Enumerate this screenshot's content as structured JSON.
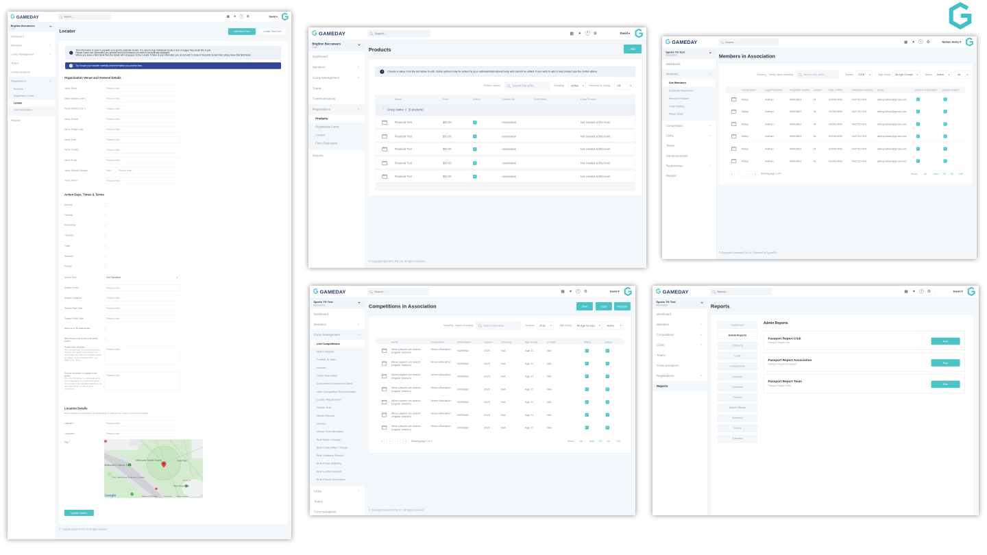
{
  "common": {
    "brand": "GAMEDAY",
    "search_placeholder": "Search...",
    "table_search_placeholder": "Search this table...",
    "accent": "#4cc3c7",
    "tip_color": "#2f4795",
    "icons": [
      "building-icon",
      "rocket-icon",
      "help-icon",
      "settings-icon"
    ]
  },
  "panels": {
    "locator": {
      "user": "David",
      "sidebar": {
        "org_name": "Brighton Buccaneers",
        "org_type": "Club",
        "items": [
          {
            "label": "Dashboard"
          },
          {
            "label": "Members",
            "expandable": true
          },
          {
            "label": "Comp Management",
            "expandable": true
          },
          {
            "label": "Teams"
          },
          {
            "label": "Communications"
          },
          {
            "label": "Registrations",
            "expandable": true,
            "open": true,
            "sub": [
              {
                "label": "Products"
              },
              {
                "label": "Registration Forms"
              },
              {
                "label": "Locator",
                "active": true
              },
              {
                "label": "Form Restrictions"
              }
            ]
          },
          {
            "label": "Reports"
          }
        ]
      },
      "title": "Locator",
      "actions": [
        "Add New Form",
        "Create Test Form"
      ],
      "info": [
        "This information is used to populate your sport's postcode locator. It is used to help individuals locate a club or league they would like to join.",
        "Please ensure the information you provide here is information you wish to be publically displayed.",
        "Where you leave a field blank then the details will not appear on the Locator. If there is any information you do not wish to show in the public locator then simply leave that field blank."
      ],
      "tip": "Tip: Ensure you consider carefully what information you provide here.",
      "section_venue": "Organisation Venue and General Details",
      "placeholder": "Please enter...",
      "venue_fields": [
        "Venue Name",
        "Venue Address Line 1",
        "Venue Address Line 2",
        "Venue Suburb",
        "Venue Postal Code",
        "Venue State",
        "Venue Country",
        "Venue Email",
        "Venue Website Address",
        "Venue Phone"
      ],
      "website_prefix": "http://",
      "section_days": "Active Days, Times & Terms",
      "days": [
        "Monday",
        "Tuesday",
        "Wednesday",
        "Thursday",
        "Friday",
        "Saturday",
        "Sunday"
      ],
      "school_term": {
        "label": "School Term",
        "value": "Not Specified"
      },
      "season_fields": [
        "Season Times",
        "Season Durations",
        "Season Start Date",
        "Season Finish Date"
      ],
      "public_checks": [
        "Show me in the public locator",
        "Show fixtures and results in the public locator"
      ],
      "textareas": [
        {
          "label": "Postal Codes Serviced",
          "help": "(You can just enter the postcodes a club services to a range of 10 relevant and local codes. You can enter multiple values by using a comma between them. eg. 3000, 3121, 3032)"
        },
        {
          "label": "General information to display on the locator",
          "help": "(Tip: Use this section to tell people about your organisation or provide information not covered in the standard fields here. It's your opportunity to make a great impression.)"
        }
      ],
      "section_location": "Location Details",
      "location_hint": "Enter Latitude and Longitude in the boxes below or drag the map marker to the correct location.",
      "location_fields": [
        "Latitude",
        "Longitude"
      ],
      "map_label": "Map",
      "required_mark": "*",
      "map": {
        "labels": [
          "Melbourne Cricket Ground",
          "Yarra Park",
          "Melbourne & Olympic Parks",
          "Rod Laver Arena Temporary Carpark",
          "Punt Road Oval",
          "Royal Vic"
        ],
        "google": "Google",
        "attribution": "Map data ©2020 Google",
        "terms": "Terms of Use",
        "report": "Report a map error"
      },
      "submit": "Update Locator",
      "footer": "© Copyright SportsTG Pty Ltd. All rights reserved."
    },
    "products": {
      "user": "David",
      "sidebar": {
        "org_name": "Brighton Buccaneers",
        "org_type": "Club",
        "items": [
          {
            "label": "Dashboard"
          },
          {
            "label": "Members",
            "expandable": true
          },
          {
            "label": "Comp Management",
            "expandable": true
          },
          {
            "label": "Teams"
          },
          {
            "label": "Communications"
          },
          {
            "label": "Registrations",
            "expandable": true,
            "open": true,
            "sub": [
              {
                "label": "Products",
                "active": true
              },
              {
                "label": "Registration Forms"
              },
              {
                "label": "Locator"
              },
              {
                "label": "Form Restrictions"
              }
            ]
          },
          {
            "label": "Reports"
          }
        ]
      },
      "title": "Products",
      "add": "Add",
      "info": "Choose a value from the list below to edit. Some options may be locked by your national/international body and cannot be edited. If you wish to add a new product use the button above.",
      "filters": {
        "product_name": "Product Name:",
        "showing": "Showing:",
        "showing_value": "Active",
        "records": "Records for Group:",
        "records_value": "All"
      },
      "headers": [
        "Name",
        "Price",
        "Active?",
        "Created By",
        "Split Name",
        "Copy Product"
      ],
      "group": {
        "name": "Group Name: 0",
        "count": "[5 products]"
      },
      "rows": [
        {
          "name": "Financial Test",
          "price": "$50.00",
          "active": true,
          "created_by": "Association",
          "split": "",
          "copy": "Not created at this level"
        },
        {
          "name": "Financial Test",
          "price": "$50.00",
          "active": true,
          "created_by": "Association",
          "split": "",
          "copy": "Not created at this level"
        },
        {
          "name": "Financial Test",
          "price": "$50.00",
          "active": true,
          "created_by": "Association",
          "split": "",
          "copy": "Not created at this level"
        },
        {
          "name": "Financial Test",
          "price": "$50.00",
          "active": true,
          "created_by": "Association",
          "split": "",
          "copy": "Not created at this level"
        },
        {
          "name": "Financial Test",
          "price": "$50.00",
          "active": true,
          "created_by": "Association",
          "split": "",
          "copy": "Not created at this level"
        }
      ],
      "footer": "© Copyright SportsTG Pty Ltd. All rights reserved."
    },
    "members": {
      "user": "Nathan Abley",
      "sidebar": {
        "org_name": "Sports TG Test",
        "org_type": "Association",
        "items": [
          {
            "label": "Dashboard"
          },
          {
            "label": "Members",
            "expandable": true,
            "open": true,
            "sub": [
              {
                "label": "List Members",
                "active": true
              },
              {
                "label": "Duplicate Resolution"
              },
              {
                "label": "Member Rollover"
              },
              {
                "label": "Card Printing"
              },
              {
                "label": "Player Stats"
              }
            ]
          },
          {
            "label": "Competitions",
            "expandable": true
          },
          {
            "label": "Clubs",
            "expandable": true
          },
          {
            "label": "Teams"
          },
          {
            "label": "Communications"
          },
          {
            "label": "Registrations",
            "expandable": true
          },
          {
            "label": "Reports"
          }
        ]
      },
      "title": "Members in Association",
      "filters": {
        "showing": "Showing - Family name including:",
        "season": "Season:",
        "season_value": "2018",
        "age_group": "Age Group:",
        "age_group_value": "All Age Groups",
        "status": "Status:",
        "status_value": "Active",
        "extra_value": "All"
      },
      "headers": [
        "Family Name",
        "Legal Firstname",
        "FootyWeb Number",
        "Gender",
        "Date of Birth",
        "Telephone Number",
        "Email",
        "Active in Association",
        "Season Player?"
      ],
      "rows": [
        {
          "family": "Abley",
          "first": "Nathan",
          "number": "00649823",
          "gender": "M",
          "dob": "02/06/1998",
          "phone": "0427517401",
          "email": "ableynathan@gmail.com",
          "active": true,
          "season_player": true
        },
        {
          "family": "Abley",
          "first": "Nathan",
          "number": "00649822",
          "gender": "M",
          "dob": "02/06/1998",
          "phone": "0427517401",
          "email": "ableynathan@gmail.com",
          "active": true,
          "season_player": true
        },
        {
          "family": "Abley",
          "first": "Nathan",
          "number": "00649822",
          "gender": "M",
          "dob": "02/06/1998",
          "phone": "0427517401",
          "email": "ableynathan@gmail.com",
          "active": true,
          "season_player": true
        },
        {
          "family": "Abley",
          "first": "Nathan",
          "number": "00649823",
          "gender": "M",
          "dob": "02/06/1998",
          "phone": "0427517401",
          "email": "ableynathan@gmail.com",
          "active": true,
          "season_player": true
        },
        {
          "family": "Abley",
          "first": "Nathan",
          "number": "00649822",
          "gender": "M",
          "dob": "02/06/1998",
          "phone": "0427517401",
          "email": "ableynathan@gmail.com",
          "active": true,
          "season_player": true
        },
        {
          "family": "Abley",
          "first": "Nathan",
          "number": "00649822",
          "gender": "M",
          "dob": "02/06/1998",
          "phone": "0427517401",
          "email": "ableynathan@gmail.com",
          "active": true,
          "season_player": true
        }
      ],
      "pagination": {
        "status": "Showing page 1 of 4",
        "show": "Show:",
        "options": [
          "All",
          "Auto",
          "25",
          "50",
          "100"
        ]
      },
      "footer": "© Copyright Gameday Pty Ltd. Powered by SportsTG"
    },
    "competitions": {
      "user": "David",
      "sidebar": {
        "org_name": "Sports TG Test",
        "org_type": "Association",
        "items": [
          {
            "label": "Dashboard"
          },
          {
            "label": "Members",
            "expandable": true
          },
          {
            "label": "Comp Management",
            "expandable": true,
            "open": true,
            "sub": [
              {
                "label": "List Competitions",
                "active": true
              },
              {
                "label": "Match Results"
              },
              {
                "label": "Publish To Web"
              },
              {
                "label": "Awards"
              },
              {
                "label": "Clash Resolution"
              },
              {
                "label": "Competition Exception Dates"
              },
              {
                "label": "Hide Competition Rounds/Dates"
              },
              {
                "label": "Ladder Adjustments"
              },
              {
                "label": "Fixture Grid"
              },
              {
                "label": "Media Reports"
              },
              {
                "label": "Venues"
              },
              {
                "label": "Venue Time Allocation"
              },
              {
                "label": "Bulk Match Change"
              },
              {
                "label": "Bulk Competition Change"
              },
              {
                "label": "Bulk Statistics Rebuild"
              },
              {
                "label": "Bulk Finals Eligibility"
              },
              {
                "label": "Bulk Ladder Rebuild"
              },
              {
                "label": "Bulk Fixture Generation"
              }
            ]
          },
          {
            "label": "Clubs",
            "expandable": true
          },
          {
            "label": "Teams"
          },
          {
            "label": "Communications"
          }
        ]
      },
      "title": "Competitions in Association",
      "actions": [
        "New",
        "Copy",
        "Regrade"
      ],
      "filters": {
        "showing": "Showing - Name including:",
        "season": "Season:",
        "season_value": "2018",
        "age_group": "Age Group:",
        "age_group_value": "All Age Groups",
        "status_value": "Active"
      },
      "headers": [
        "Name",
        "Competition",
        "Abbreviation",
        "Season",
        "Grouping",
        "Age Group",
        "Contact",
        "Status",
        "Upload"
      ],
      "rows": [
        {
          "name": "Allow players via search (regular season)",
          "competition": "Venue Allocation",
          "abbr": "W20MaD",
          "season": "2020",
          "grouping": "N/A",
          "age": "Age 21",
          "contact": "N/A",
          "status": true,
          "upload": true
        },
        {
          "name": "Allow players via search (regular season)",
          "competition": "Venue Allocation",
          "abbr": "W20MaD",
          "season": "2020",
          "grouping": "N/A",
          "age": "Age 21",
          "contact": "N/A",
          "status": true,
          "upload": true
        },
        {
          "name": "Allow players via search (regular season)",
          "competition": "Venue Allocation",
          "abbr": "W20MaD",
          "season": "2020",
          "grouping": "N/A",
          "age": "Age 21",
          "contact": "N/A",
          "status": true,
          "upload": true
        },
        {
          "name": "Allow players via search (regular season)",
          "competition": "Venue Allocation",
          "abbr": "W20MaD",
          "season": "2020",
          "grouping": "N/A",
          "age": "Age 21",
          "contact": "N/A",
          "status": true,
          "upload": true
        },
        {
          "name": "Allow players via search (regular season)",
          "competition": "Venue Allocation",
          "abbr": "W20MaD",
          "season": "2020",
          "grouping": "N/A",
          "age": "Age 21",
          "contact": "N/A",
          "status": true,
          "upload": true
        },
        {
          "name": "Allow players via search (regular season)",
          "competition": "Venue Allocation",
          "abbr": "W20MaD",
          "season": "2020",
          "grouping": "N/A",
          "age": "Age 21",
          "contact": "N/A",
          "status": true,
          "upload": true
        },
        {
          "name": "Allow players via search (regular season)",
          "competition": "Venue Allocation",
          "abbr": "W20MaD",
          "season": "2020",
          "grouping": "N/A",
          "age": "Age 21",
          "contact": "N/A",
          "status": true,
          "upload": true
        }
      ],
      "pagination": {
        "status": "Showing page 1 of 4",
        "show": "Show:",
        "options": [
          "All",
          "Auto",
          "25",
          "50",
          "100"
        ]
      },
      "footer": "© Copyright SportsTG Pty Ltd. All rights reserved."
    },
    "reports": {
      "user": "David",
      "sidebar": {
        "org_name": "Sports TG Test",
        "org_type": "Association",
        "items": [
          {
            "label": "Dashboard"
          },
          {
            "label": "Members",
            "expandable": true
          },
          {
            "label": "Competitions",
            "expandable": true
          },
          {
            "label": "Clubs",
            "expandable": true
          },
          {
            "label": "Teams"
          },
          {
            "label": "Communications"
          },
          {
            "label": "Registrations",
            "expandable": true
          },
          {
            "label": "Reports",
            "active": true
          }
        ]
      },
      "title": "Reports",
      "nav": [
        {
          "label": "Dashboard"
        },
        {
          "label": "Admin Reports",
          "active": true
        },
        {
          "label": "COVID-19"
        },
        {
          "label": "Clubs"
        },
        {
          "label": "Competitions"
        },
        {
          "label": "Contacts"
        },
        {
          "label": "Courtside"
        },
        {
          "label": "Finance"
        },
        {
          "label": "Match Officials"
        },
        {
          "label": "Members"
        },
        {
          "label": "Teams"
        },
        {
          "label": "Tribunals"
        }
      ],
      "section": "Admin Reports",
      "reports": [
        {
          "title": "Passport Report Club",
          "subtitle": "Passport Report Club",
          "action": "Run"
        },
        {
          "title": "Passport Report Association",
          "subtitle": "Passport Report Association",
          "action": "Run"
        },
        {
          "title": "Passport Report Team",
          "subtitle": "Passport Report Team",
          "action": "Run"
        }
      ]
    }
  }
}
